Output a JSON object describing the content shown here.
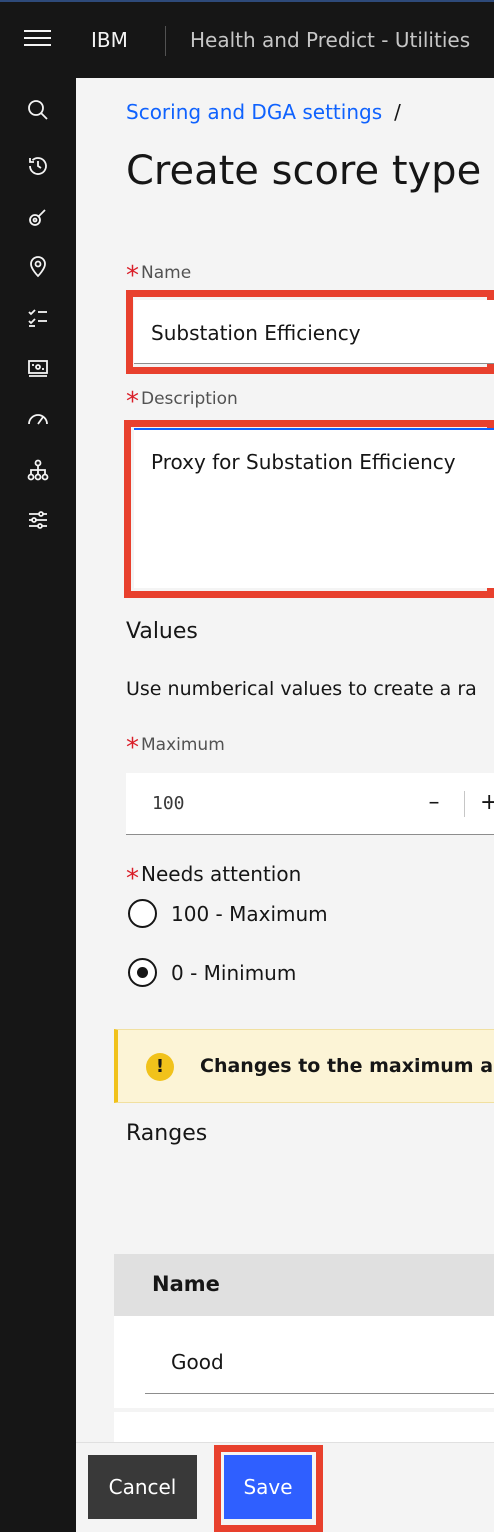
{
  "header": {
    "brand": "IBM",
    "product": "Health and Predict - Utilities",
    "menu_icon": "hamburger-menu-icon"
  },
  "rail": {
    "icons": [
      "search-icon",
      "history-icon",
      "satellite-icon",
      "location-icon",
      "checklist-icon",
      "dashboard-card-icon",
      "gauge-icon",
      "hierarchy-icon",
      "settings-adjust-icon"
    ]
  },
  "breadcrumb": {
    "link": "Scoring and DGA settings",
    "separator": "/"
  },
  "page": {
    "title": "Create score type a"
  },
  "form": {
    "name_label": "Name",
    "name_value": "Substation Efficiency",
    "description_label": "Description",
    "description_value": "Proxy for Substation Efficiency",
    "required_mark": "*"
  },
  "values": {
    "title": "Values",
    "helper": "Use numberical values to create a ra",
    "maximum_label": "Maximum",
    "maximum_value": "100",
    "minus": "–",
    "plus": "+",
    "needs_attention_label": "Needs attention",
    "options": [
      "100 - Maximum",
      "0 - Minimum"
    ],
    "selected_index": 1
  },
  "notice": {
    "icon": "warning-icon",
    "icon_glyph": "!",
    "text": "Changes to the maximum an"
  },
  "ranges": {
    "title": "Ranges",
    "column_name": "Name",
    "rows": [
      "Good"
    ]
  },
  "footer": {
    "cancel_label": "Cancel",
    "save_label": "Save"
  },
  "colors": {
    "highlight": "#e8402d",
    "primary": "#0f62fe",
    "required": "#da1e28",
    "warning": "#f1c21b"
  }
}
